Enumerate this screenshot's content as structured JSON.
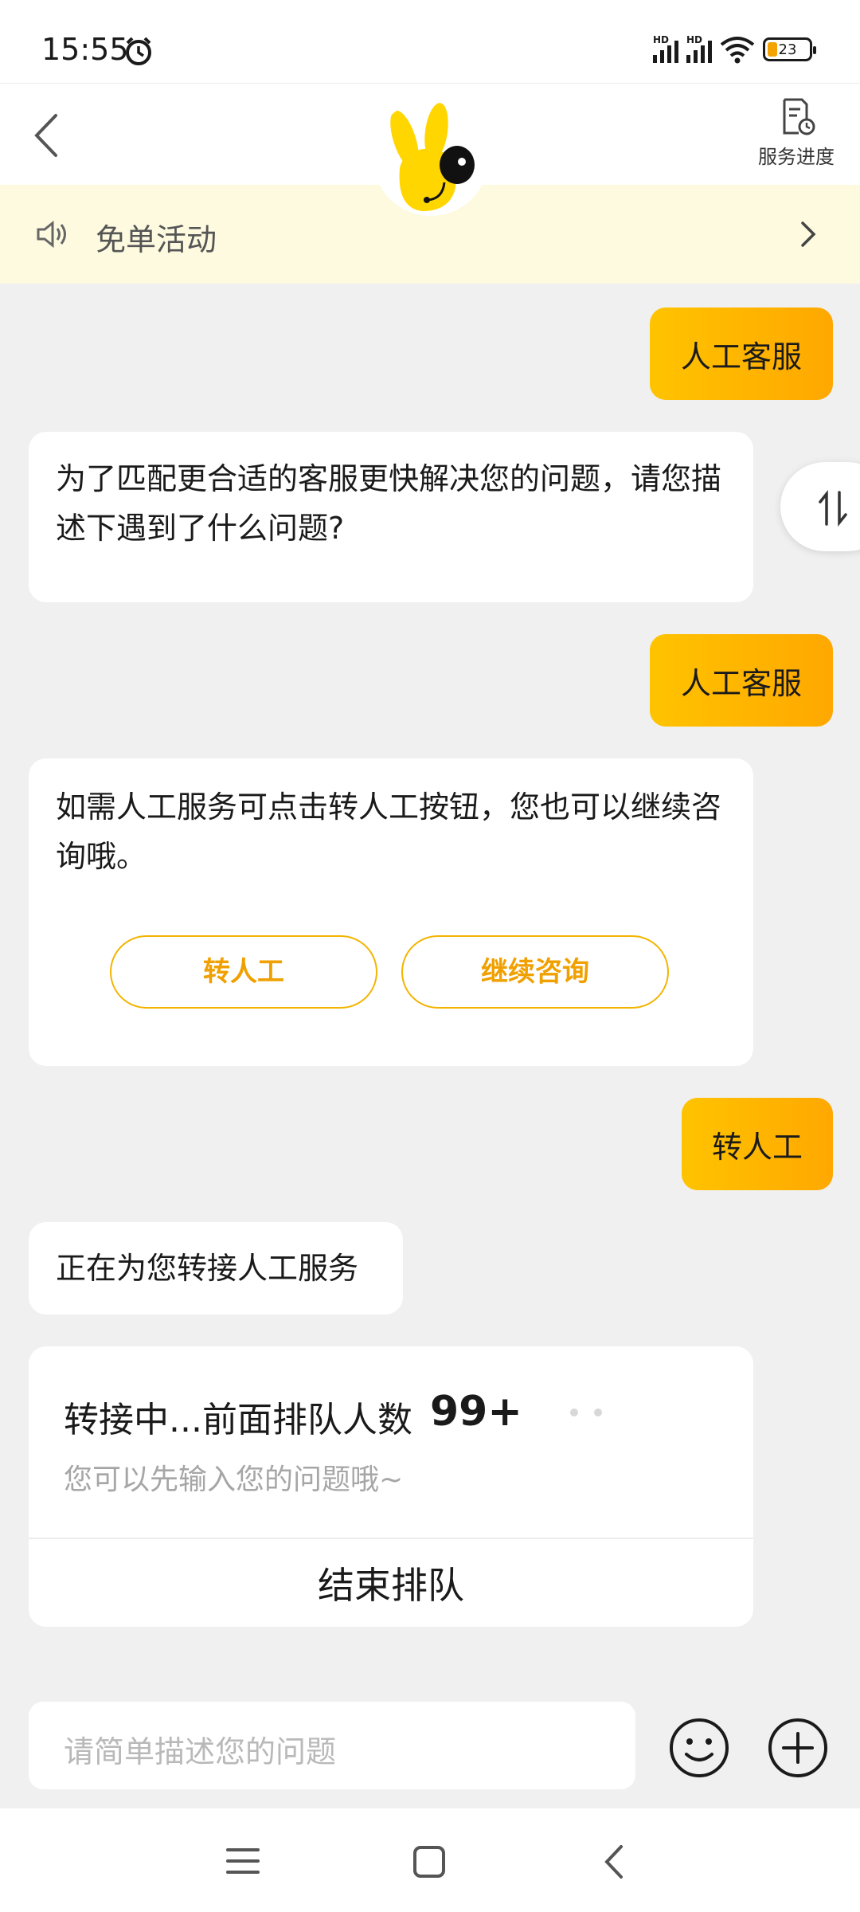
{
  "status_bar": {
    "time": "15:55",
    "battery": "23",
    "signal_label_1": "HD",
    "signal_label_2": "HD"
  },
  "header": {
    "progress_label": "服务进度"
  },
  "notice": {
    "text": "免单活动"
  },
  "messages": {
    "user_1": "人工客服",
    "bot_1": "为了匹配更合适的客服更快解决您的问题，请您描述下遇到了什么问题?",
    "user_2": "人工客服",
    "bot_2": "如需人工服务可点击转人工按钮，您也可以继续咨询哦。",
    "bot_2_button_transfer": "转人工",
    "bot_2_button_continue": "继续咨询",
    "user_3": "转人工",
    "bot_3": "正在为您转接人工服务"
  },
  "queue": {
    "title": "转接中...前面排队人数",
    "count": "99+",
    "hint": "您可以先输入您的问题哦~",
    "end_label": "结束排队"
  },
  "input": {
    "placeholder": "请简单描述您的问题"
  },
  "colors": {
    "accent": "#ffb300",
    "notice_bg": "#fdfae0",
    "pill_text": "#f0a000"
  }
}
